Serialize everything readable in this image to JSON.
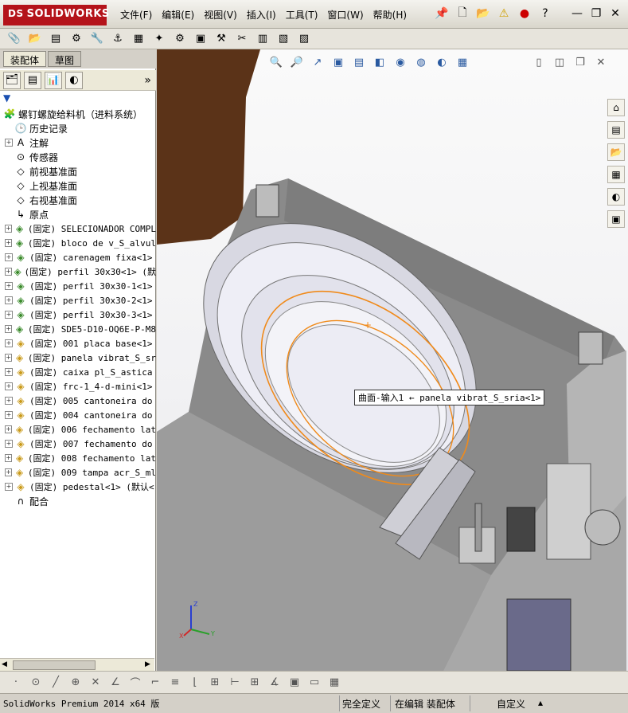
{
  "app": {
    "logo_prefix": "DS",
    "logo_text": "SOLIDWORKS"
  },
  "menu": [
    "文件(F)",
    "编辑(E)",
    "视图(V)",
    "插入(I)",
    "工具(T)",
    "窗口(W)",
    "帮助(H)"
  ],
  "quick_tools": {
    "pin": "📌",
    "new": "🗋",
    "open": "📂",
    "warning": "⚠",
    "traffic": "●",
    "help": "?"
  },
  "window_controls": {
    "minimize": "—",
    "restore": "❐",
    "close": "✕"
  },
  "toolbar_icons": [
    "📎",
    "📂",
    "▤",
    "⚙",
    "🔧",
    "⚓",
    "▦",
    "✦",
    "⚙",
    "▣",
    "⚒",
    "✂",
    "▥",
    "▧",
    "▨"
  ],
  "panel": {
    "tabs": [
      "装配体",
      "草图"
    ],
    "fm_icons": [
      "🗂",
      "▤",
      "📊",
      "◐"
    ],
    "more": "»",
    "filter": "▼",
    "tree": [
      {
        "label": "螺钉螺旋给料机（进料系统）",
        "kind": "root"
      },
      {
        "label": "历史记录",
        "kind": "history",
        "expand": false
      },
      {
        "label": "注解",
        "kind": "annot",
        "expand": true
      },
      {
        "label": "传感器",
        "kind": "sensor",
        "expand": false
      },
      {
        "label": "前视基准面",
        "kind": "plane",
        "expand": false
      },
      {
        "label": "上视基准面",
        "kind": "plane",
        "expand": false
      },
      {
        "label": "右视基准面",
        "kind": "plane",
        "expand": false
      },
      {
        "label": "原点",
        "kind": "origin",
        "expand": false
      },
      {
        "label": "(固定) SELECIONADOR COMPL",
        "kind": "asm",
        "expand": true
      },
      {
        "label": "(固定) bloco de v_S_alvul",
        "kind": "asm",
        "expand": true
      },
      {
        "label": "(固定) carenagem fixa<1>",
        "kind": "asm",
        "expand": true
      },
      {
        "label": "(固定) perfil 30x30<1> (默",
        "kind": "asm",
        "expand": true
      },
      {
        "label": "(固定) perfil 30x30-1<1>",
        "kind": "asm",
        "expand": true
      },
      {
        "label": "(固定) perfil 30x30-2<1>",
        "kind": "asm",
        "expand": true
      },
      {
        "label": "(固定) perfil 30x30-3<1>",
        "kind": "asm",
        "expand": true
      },
      {
        "label": "(固定) SDE5-D10-OQ6E-P-M8",
        "kind": "asm",
        "expand": true
      },
      {
        "label": "(固定) 001 placa base<1>",
        "kind": "part",
        "expand": true
      },
      {
        "label": "(固定) panela vibrat_S_sr",
        "kind": "part",
        "expand": true
      },
      {
        "label": "(固定) caixa pl_S_astica",
        "kind": "part",
        "expand": true
      },
      {
        "label": "(固定) frc-1_4-d-mini<1>",
        "kind": "part",
        "expand": true
      },
      {
        "label": "(固定) 005 cantoneira do",
        "kind": "part",
        "expand": true
      },
      {
        "label": "(固定) 004 cantoneira do",
        "kind": "part",
        "expand": true
      },
      {
        "label": "(固定) 006 fechamento lat",
        "kind": "part",
        "expand": true
      },
      {
        "label": "(固定) 007 fechamento do",
        "kind": "part",
        "expand": true
      },
      {
        "label": "(固定) 008 fechamento lat",
        "kind": "part",
        "expand": true
      },
      {
        "label": "(固定) 009 tampa acr_S_ml",
        "kind": "part",
        "expand": true
      },
      {
        "label": "(固定) pedestal<1> (默认<",
        "kind": "part",
        "expand": true
      },
      {
        "label": "配合",
        "kind": "mate",
        "expand": false
      }
    ]
  },
  "viewport": {
    "callout": "曲面-输入1 ← panela vibrat_S_sria<1>",
    "headsup_icons": [
      "🔍",
      "🔎",
      "↗",
      "▣",
      "▤",
      "◧",
      "◉",
      "◍",
      "◐",
      "▦"
    ],
    "view_controls": [
      "▯",
      "◫",
      "❐",
      "✕"
    ],
    "taskpane_icons": [
      "⌂",
      "▤",
      "📂",
      "▦",
      "◐",
      "▣"
    ],
    "triad": {
      "x": "X",
      "y": "Y",
      "z": "Z"
    }
  },
  "bottom_tools": [
    "·",
    "⊙",
    "╱",
    "⊕",
    "✕",
    "∠",
    "⌒",
    "⌐",
    "≡",
    "⌊",
    "⊞",
    "⊢",
    "⊞",
    "∡",
    "▣",
    "▭",
    "▦"
  ],
  "status": {
    "product": "SolidWorks Premium 2014 x64 版",
    "defined": "完全定义",
    "editing": "在编辑 装配体",
    "custom": "自定义",
    "arrow": "▴"
  },
  "colors": {
    "accent": "#b4131a",
    "highlight": "#f08a1a",
    "tree_green": "#3a8a2b"
  }
}
